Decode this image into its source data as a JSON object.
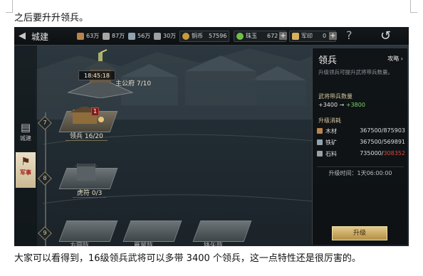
{
  "document": {
    "line_top": "之后要升升领兵。",
    "line_bottom": "大家可以看得到，16级领兵武将可以多带 3400 个领兵，这一点特性还是很厉害的。"
  },
  "topbar": {
    "title": "城建",
    "resources": [
      {
        "name": "wood",
        "icon": "wood-icon",
        "color": "#b9854a",
        "value": "63万"
      },
      {
        "name": "weapon",
        "icon": "sword-icon",
        "color": "#a7a7a7",
        "value": "87万"
      },
      {
        "name": "iron",
        "icon": "ore-icon",
        "color": "#8fa3b1",
        "value": "56万"
      },
      {
        "name": "stone",
        "icon": "stone-icon",
        "color": "#9aa0a3",
        "value": "30万"
      }
    ],
    "copper_label": "铜币",
    "copper_value": "57596",
    "pearl_label": "珠玉",
    "pearl_value": "672",
    "token_label": "军印",
    "token_value": "0"
  },
  "tabs": [
    {
      "label": "城建",
      "icon": "city-icon",
      "active": false
    },
    {
      "label": "军事",
      "icon": "flag-icon",
      "active": true
    }
  ],
  "tree": {
    "levels": [
      "7",
      "8",
      "9"
    ],
    "main_building": {
      "label": "主公府 7/10",
      "timer": "18:45:18"
    },
    "barracks": {
      "label": "领兵 16/20",
      "badge": "1"
    },
    "tiger_tally": {
      "label": "虎符 0/3"
    },
    "row9": [
      "方圆阵",
      "雁翼阵",
      "锋矢阵"
    ]
  },
  "panel": {
    "title": "领兵",
    "guide": "攻略",
    "desc": "升级领兵可提升武将带兵数量。",
    "cap_title": "武将带兵数量",
    "cap_from": "+3400",
    "cap_to": "+3800",
    "cost_title": "升级消耗",
    "costs": [
      {
        "name": "木材",
        "have": "367500",
        "need": "875903",
        "icon": "wood-icon",
        "color": "#b9854a",
        "short": false
      },
      {
        "name": "铁矿",
        "have": "367500",
        "need": "569891",
        "icon": "ore-icon",
        "color": "#8fa3b1",
        "short": false
      },
      {
        "name": "石料",
        "have": "735000",
        "need": "308352",
        "icon": "stone-icon",
        "color": "#9aa0a3",
        "short": true
      }
    ],
    "time_label": "升级时间：",
    "time_value": "1天06:00:00",
    "upgrade_label": "升级"
  }
}
